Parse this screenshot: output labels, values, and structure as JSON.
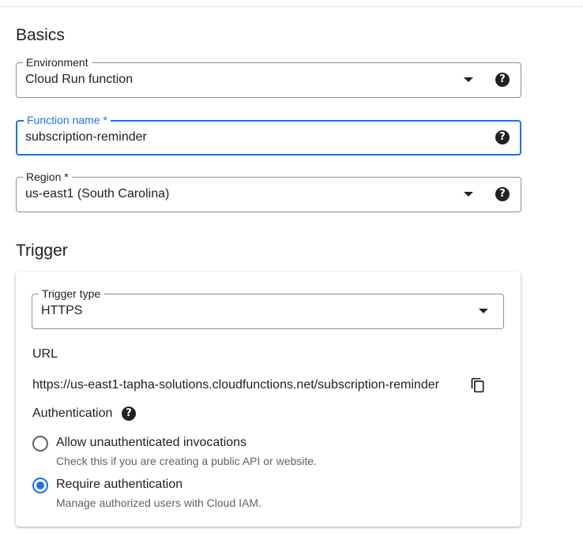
{
  "basics": {
    "title": "Basics",
    "environment": {
      "label": "Environment",
      "value": "Cloud Run function"
    },
    "function_name": {
      "label": "Function name *",
      "value": "subscription-reminder"
    },
    "region": {
      "label": "Region *",
      "value": "us-east1 (South Carolina)"
    }
  },
  "trigger": {
    "title": "Trigger",
    "trigger_type": {
      "label": "Trigger type",
      "value": "HTTPS"
    },
    "url_heading": "URL",
    "url": "https://us-east1-tapha-solutions.cloudfunctions.net/subscription-reminder",
    "authentication": {
      "heading": "Authentication",
      "options": [
        {
          "label": "Allow unauthenticated invocations",
          "description": "Check this if you are creating a public API or website.",
          "selected": false
        },
        {
          "label": "Require authentication",
          "description": "Manage authorized users with Cloud IAM.",
          "selected": true
        }
      ]
    }
  },
  "icons": {
    "help": "help-circle-icon",
    "dropdown": "arrow-drop-down-icon",
    "copy": "copy-icon"
  },
  "colors": {
    "accent": "#1a73e8",
    "text": "#202124",
    "secondary_text": "#5f6368"
  }
}
